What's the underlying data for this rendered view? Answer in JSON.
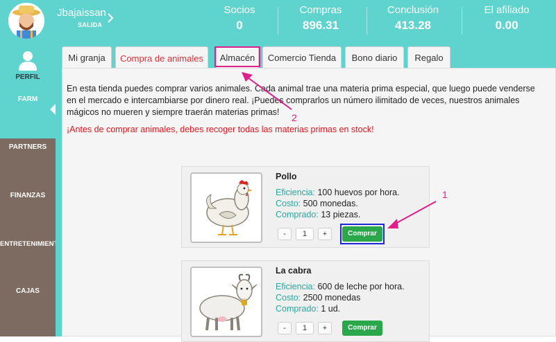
{
  "header": {
    "username": "Jbajaissan",
    "logout": "SALIDA",
    "stats": [
      {
        "label": "Socios",
        "value": "0"
      },
      {
        "label": "Compras",
        "value": "896.31"
      },
      {
        "label": "Conclusión",
        "value": "413.28"
      },
      {
        "label": "El afiliado",
        "value": "0.00"
      }
    ]
  },
  "sidebar": {
    "items": [
      "PERFIL",
      "FARM",
      "PARTNERS",
      "FINANZAS",
      "ENTRETENIMIENTO",
      "CAJAS"
    ]
  },
  "tabs": [
    "Mi granja",
    "Compra de animales",
    "Almacén",
    "Comercio Tienda",
    "Bono diario",
    "Regalo"
  ],
  "intro": "En esta tienda puedes comprar varios animales. Cada animal trae una materia prima especial, que luego puede venderse en el mercado e intercambiarse por dinero real. ¡Puedes comprarlos un número ilimitado de veces, nuestros animales mágicos no mueren y siempre traerán materias primas!",
  "warning": "¡Antes de comprar animales, debes recoger todas las materias primas en stock!",
  "animals": [
    {
      "name": "Pollo",
      "eff_label": "Eficiencia:",
      "eff_value": "100 huevos por hora.",
      "cost_label": "Costo:",
      "cost_value": "500 monedas.",
      "bought_label": "Comprado:",
      "bought_value": "13 piezas.",
      "qty": "1",
      "minus": "-",
      "plus": "+",
      "buy": "Comprar"
    },
    {
      "name": "La cabra",
      "eff_label": "Eficiencia:",
      "eff_value": "600 de leche por hora.",
      "cost_label": "Costo:",
      "cost_value": "2500 monedas",
      "bought_label": "Comprado:",
      "bought_value": "1 ud.",
      "qty": "1",
      "minus": "-",
      "plus": "+",
      "buy": "Comprar"
    }
  ],
  "annotations": {
    "one": "1",
    "two": "2"
  },
  "colors": {
    "teal": "#5fd3cd",
    "sidebar": "#7d6a60",
    "buy": "#2aa74a",
    "highlight_pink": "#e01e8c",
    "highlight_blue": "#1e27d6",
    "warning": "#e0161e"
  }
}
